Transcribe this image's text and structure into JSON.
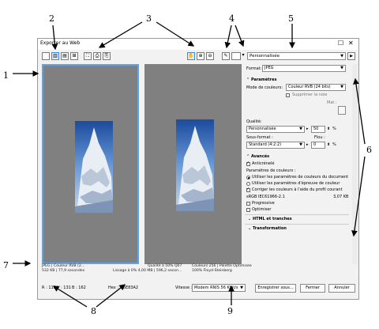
{
  "callouts": [
    "1",
    "2",
    "3",
    "4",
    "5",
    "6",
    "7",
    "8",
    "9"
  ],
  "window": {
    "title": "Exporter au Web"
  },
  "toolbar": {
    "preset": "Personnalisée"
  },
  "left_preview": {
    "info_l1": "JPEG  |  Couleur RVB (2...",
    "info_l2": "532 KB  |  77,9 secondes",
    "info_r1": "Qualité à 50%  Q07",
    "info_r2": "Lissage à 0%  4,00 MB  |  596,2 secon..."
  },
  "right_preview": {
    "info_l1": "Couleurs 256  |  Palette Optimisée",
    "info_l2": "100% Floyd-Steinberg"
  },
  "panel": {
    "format_label": "Format:",
    "format_value": "JPEG",
    "params_header": "Paramètres",
    "color_mode_label": "Mode de couleurs:",
    "color_mode_value": "Couleur RVB (24 bits)",
    "remove_noise": "Supprimer la noie",
    "mat_label": "Mat :",
    "quality_label": "Qualité:",
    "quality_preset": "Personnalisée",
    "quality_value": "50",
    "percent": "%",
    "subformat_label": "Sous-format :",
    "blur_label": "Flou :",
    "subformat_value": "Standard (4:2:2)",
    "blur_value": "0",
    "advanced_header": "Avancés",
    "antialias": "Anticrénelé",
    "color_params": "Paramètres de couleurs :",
    "radio1": "Utiliser les paramètres de couleurs du document",
    "radio2": "Utiliser les paramètres d'épreuve de couleur",
    "convert": "Corriger les couleurs à l'aide du profil courant",
    "profile": "sRGB IEC61966-2.1",
    "profile_size": "3,07 KB",
    "progressive": "Progressive",
    "optimize": "Optimiser",
    "html_header": "HTML et tranches",
    "transform_header": "Transformation"
  },
  "status": {
    "r": "R : 110",
    "g": "V : 131",
    "b": "B : 162",
    "hex": "Hex : #6E83A2",
    "speed_label": "Vitesse :",
    "speed_value": "Modem RNIS 56 Kbit/s",
    "save_btn": "Enregistrer sous...",
    "close_btn": "Fermer",
    "cancel_btn": "Annuler"
  },
  "colors": {
    "accent": "#5aa6e8",
    "preview_bg": "#808080"
  }
}
